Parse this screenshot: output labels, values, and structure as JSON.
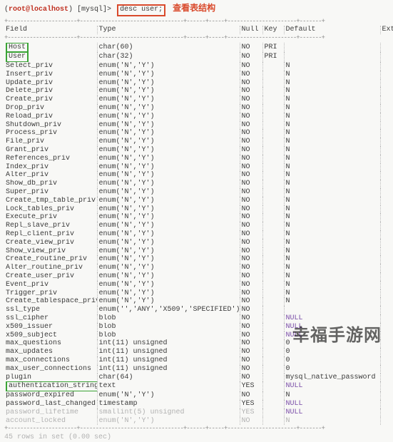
{
  "prompt": {
    "user_host": "root@localhost",
    "context": "[mysql]>",
    "command": "desc user;",
    "annotation": "查看表结构"
  },
  "headers": {
    "field": "Field",
    "type": "Type",
    "null": "Null",
    "key": "Key",
    "default": "Default",
    "extra": "Extra"
  },
  "rows": [
    {
      "field": "Host",
      "type": "char(60)",
      "null": "NO",
      "key": "PRI",
      "default": "",
      "hl": true
    },
    {
      "field": "User",
      "type": "char(32)",
      "null": "NO",
      "key": "PRI",
      "default": "",
      "hl": true
    },
    {
      "field": "Select_priv",
      "type": "enum('N','Y')",
      "null": "NO",
      "key": "",
      "default": "N"
    },
    {
      "field": "Insert_priv",
      "type": "enum('N','Y')",
      "null": "NO",
      "key": "",
      "default": "N"
    },
    {
      "field": "Update_priv",
      "type": "enum('N','Y')",
      "null": "NO",
      "key": "",
      "default": "N"
    },
    {
      "field": "Delete_priv",
      "type": "enum('N','Y')",
      "null": "NO",
      "key": "",
      "default": "N"
    },
    {
      "field": "Create_priv",
      "type": "enum('N','Y')",
      "null": "NO",
      "key": "",
      "default": "N"
    },
    {
      "field": "Drop_priv",
      "type": "enum('N','Y')",
      "null": "NO",
      "key": "",
      "default": "N"
    },
    {
      "field": "Reload_priv",
      "type": "enum('N','Y')",
      "null": "NO",
      "key": "",
      "default": "N"
    },
    {
      "field": "Shutdown_priv",
      "type": "enum('N','Y')",
      "null": "NO",
      "key": "",
      "default": "N"
    },
    {
      "field": "Process_priv",
      "type": "enum('N','Y')",
      "null": "NO",
      "key": "",
      "default": "N"
    },
    {
      "field": "File_priv",
      "type": "enum('N','Y')",
      "null": "NO",
      "key": "",
      "default": "N"
    },
    {
      "field": "Grant_priv",
      "type": "enum('N','Y')",
      "null": "NO",
      "key": "",
      "default": "N"
    },
    {
      "field": "References_priv",
      "type": "enum('N','Y')",
      "null": "NO",
      "key": "",
      "default": "N"
    },
    {
      "field": "Index_priv",
      "type": "enum('N','Y')",
      "null": "NO",
      "key": "",
      "default": "N"
    },
    {
      "field": "Alter_priv",
      "type": "enum('N','Y')",
      "null": "NO",
      "key": "",
      "default": "N"
    },
    {
      "field": "Show_db_priv",
      "type": "enum('N','Y')",
      "null": "NO",
      "key": "",
      "default": "N"
    },
    {
      "field": "Super_priv",
      "type": "enum('N','Y')",
      "null": "NO",
      "key": "",
      "default": "N"
    },
    {
      "field": "Create_tmp_table_priv",
      "type": "enum('N','Y')",
      "null": "NO",
      "key": "",
      "default": "N"
    },
    {
      "field": "Lock_tables_priv",
      "type": "enum('N','Y')",
      "null": "NO",
      "key": "",
      "default": "N"
    },
    {
      "field": "Execute_priv",
      "type": "enum('N','Y')",
      "null": "NO",
      "key": "",
      "default": "N"
    },
    {
      "field": "Repl_slave_priv",
      "type": "enum('N','Y')",
      "null": "NO",
      "key": "",
      "default": "N"
    },
    {
      "field": "Repl_client_priv",
      "type": "enum('N','Y')",
      "null": "NO",
      "key": "",
      "default": "N"
    },
    {
      "field": "Create_view_priv",
      "type": "enum('N','Y')",
      "null": "NO",
      "key": "",
      "default": "N"
    },
    {
      "field": "Show_view_priv",
      "type": "enum('N','Y')",
      "null": "NO",
      "key": "",
      "default": "N"
    },
    {
      "field": "Create_routine_priv",
      "type": "enum('N','Y')",
      "null": "NO",
      "key": "",
      "default": "N"
    },
    {
      "field": "Alter_routine_priv",
      "type": "enum('N','Y')",
      "null": "NO",
      "key": "",
      "default": "N"
    },
    {
      "field": "Create_user_priv",
      "type": "enum('N','Y')",
      "null": "NO",
      "key": "",
      "default": "N"
    },
    {
      "field": "Event_priv",
      "type": "enum('N','Y')",
      "null": "NO",
      "key": "",
      "default": "N"
    },
    {
      "field": "Trigger_priv",
      "type": "enum('N','Y')",
      "null": "NO",
      "key": "",
      "default": "N"
    },
    {
      "field": "Create_tablespace_priv",
      "type": "enum('N','Y')",
      "null": "NO",
      "key": "",
      "default": "N"
    },
    {
      "field": "ssl_type",
      "type": "enum('','ANY','X509','SPECIFIED')",
      "null": "NO",
      "key": "",
      "default": ""
    },
    {
      "field": "ssl_cipher",
      "type": "blob",
      "null": "NO",
      "key": "",
      "default": "NULL",
      "nullv": true
    },
    {
      "field": "x509_issuer",
      "type": "blob",
      "null": "NO",
      "key": "",
      "default": "NULL",
      "nullv": true
    },
    {
      "field": "x509_subject",
      "type": "blob",
      "null": "NO",
      "key": "",
      "default": "NULL",
      "nullv": true
    },
    {
      "field": "max_questions",
      "type": "int(11) unsigned",
      "null": "NO",
      "key": "",
      "default": "0"
    },
    {
      "field": "max_updates",
      "type": "int(11) unsigned",
      "null": "NO",
      "key": "",
      "default": "0"
    },
    {
      "field": "max_connections",
      "type": "int(11) unsigned",
      "null": "NO",
      "key": "",
      "default": "0"
    },
    {
      "field": "max_user_connections",
      "type": "int(11) unsigned",
      "null": "NO",
      "key": "",
      "default": "0"
    },
    {
      "field": "plugin",
      "type": "char(64)",
      "null": "NO",
      "key": "",
      "default": "mysql_native_password"
    },
    {
      "field": "authentication_string",
      "type": "text",
      "null": "YES",
      "key": "",
      "default": "NULL",
      "hl": true,
      "nullv": true
    },
    {
      "field": "password_expired",
      "type": "enum('N','Y')",
      "null": "NO",
      "key": "",
      "default": "N"
    },
    {
      "field": "password_last_changed",
      "type": "timestamp",
      "null": "YES",
      "key": "",
      "default": "NULL",
      "nullv": true
    },
    {
      "field": "password_lifetime",
      "type": "smallint(5) unsigned",
      "null": "YES",
      "key": "",
      "default": "NULL",
      "faded": true,
      "nullv": true
    },
    {
      "field": "account_locked",
      "type": "enum('N','Y')",
      "null": "NO",
      "key": "",
      "default": "N",
      "faded": true
    }
  ],
  "footer": "45 rows in set (0.00 sec)",
  "watermark": "幸福手游网"
}
